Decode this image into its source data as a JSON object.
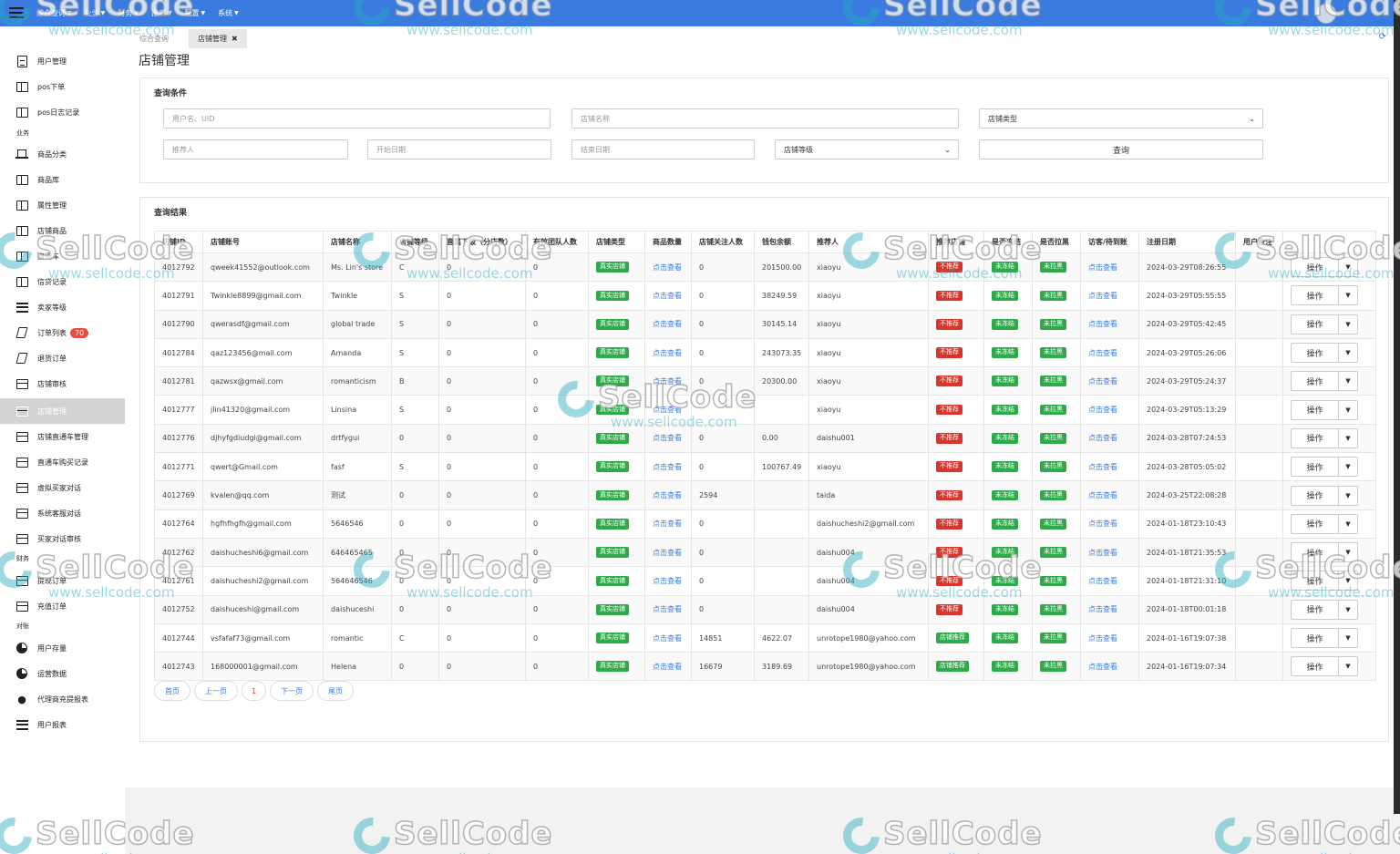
{
  "topbar": {
    "nav": [
      "综合查询",
      "业务",
      "财务",
      "报表",
      "配置",
      "系统"
    ]
  },
  "sidebar": {
    "items": [
      {
        "label": "用户管理",
        "icon": "user-doc-icon"
      },
      {
        "label": "pos下单",
        "icon": "pos-order-icon"
      },
      {
        "label": "pos日志记录",
        "icon": "pos-log-icon"
      },
      {
        "label": "商品分类",
        "icon": "laptop-icon"
      },
      {
        "label": "商品库",
        "icon": "product-lib-icon"
      },
      {
        "label": "属性管理",
        "icon": "attribute-icon"
      },
      {
        "label": "店铺商品",
        "icon": "shop-goods-icon"
      },
      {
        "label": "直通车",
        "icon": "express-icon"
      },
      {
        "label": "信贷记录",
        "icon": "credit-icon"
      },
      {
        "label": "卖家等级",
        "icon": "list-icon"
      },
      {
        "label": "订单列表",
        "icon": "order-icon",
        "badge": "70"
      },
      {
        "label": "退货订单",
        "icon": "return-icon"
      },
      {
        "label": "店铺审核",
        "icon": "audit-icon"
      },
      {
        "label": "店铺管理",
        "icon": "shop-manage-icon"
      },
      {
        "label": "店铺直通车管理",
        "icon": "shop-express-icon"
      },
      {
        "label": "直通车购买记录",
        "icon": "express-record-icon"
      },
      {
        "label": "虚拟买家对话",
        "icon": "virtual-chat-icon"
      },
      {
        "label": "系统客服对话",
        "icon": "service-chat-icon"
      },
      {
        "label": "买家对话审核",
        "icon": "chat-audit-icon"
      },
      {
        "label": "提现订单",
        "icon": "withdraw-icon"
      },
      {
        "label": "充值订单",
        "icon": "recharge-icon"
      },
      {
        "label": "用户存量",
        "icon": "pie-icon"
      },
      {
        "label": "运营数据",
        "icon": "pie-icon"
      },
      {
        "label": "代理商充提报表",
        "icon": "org-icon"
      },
      {
        "label": "用户报表",
        "icon": "list-icon"
      }
    ],
    "sections": [
      "业务",
      "财务",
      "对账"
    ]
  },
  "tabs": [
    {
      "label": "综合查询"
    },
    {
      "label": "店铺管理",
      "close": "✖"
    }
  ],
  "page_title": "店铺管理",
  "query": {
    "title": "查询条件",
    "user_placeholder": "用户名、UID",
    "shop_name_placeholder": "店铺名称",
    "shop_type_label": "店铺类型",
    "recommender_placeholder": "推荐人",
    "start_date_placeholder": "开始日期",
    "end_date_placeholder": "结束日期",
    "shop_level_label": "店铺等级",
    "search_label": "查询"
  },
  "results": {
    "title": "查询结果",
    "columns": [
      "店铺ID",
      "店铺账号",
      "店铺名称",
      "店铺等级",
      "直属下级（分店数）",
      "有效团队人数",
      "店铺类型",
      "商品数量",
      "店铺关注人数",
      "钱包余额",
      "推荐人",
      "推荐店铺",
      "是否冻结",
      "是否拉黑",
      "访客/待到账",
      "注册日期",
      "用户备注",
      ""
    ],
    "view_label": "点击查看",
    "op_label": "操作",
    "op_caret": "▼",
    "rows": [
      {
        "id": "4012792",
        "account": "qweek41552@outlook.com",
        "name": "Ms. Lin's store",
        "level": "C",
        "sub": "0",
        "team": "0",
        "type": "真实店铺",
        "followers": "0",
        "wallet": "201500.00",
        "referrer": "xiaoyu",
        "recommend": "不推荐",
        "frozen": "未冻结",
        "blacklist": "未拉黑",
        "date": "2024-03-29T08:26:55"
      },
      {
        "id": "4012791",
        "account": "Twinkle8899@gmail.com",
        "name": "Twinkle",
        "level": "S",
        "sub": "0",
        "team": "0",
        "type": "真实店铺",
        "followers": "0",
        "wallet": "38249.59",
        "referrer": "xiaoyu",
        "recommend": "不推荐",
        "frozen": "未冻结",
        "blacklist": "未拉黑",
        "date": "2024-03-29T05:55:55"
      },
      {
        "id": "4012790",
        "account": "qwerasdf@gmail.com",
        "name": "global trade",
        "level": "S",
        "sub": "0",
        "team": "0",
        "type": "真实店铺",
        "followers": "0",
        "wallet": "30145.14",
        "referrer": "xiaoyu",
        "recommend": "不推荐",
        "frozen": "未冻结",
        "blacklist": "未拉黑",
        "date": "2024-03-29T05:42:45"
      },
      {
        "id": "4012784",
        "account": "qaz123456@mail.com",
        "name": "Amanda",
        "level": "S",
        "sub": "0",
        "team": "0",
        "type": "真实店铺",
        "followers": "0",
        "wallet": "243073.35",
        "referrer": "xiaoyu",
        "recommend": "不推荐",
        "frozen": "未冻结",
        "blacklist": "未拉黑",
        "date": "2024-03-29T05:26:06"
      },
      {
        "id": "4012781",
        "account": "qazwsx@gmail.com",
        "name": "romanticism",
        "level": "B",
        "sub": "0",
        "team": "0",
        "type": "真实店铺",
        "followers": "0",
        "wallet": "20300.00",
        "referrer": "xiaoyu",
        "recommend": "不推荐",
        "frozen": "未冻结",
        "blacklist": "未拉黑",
        "date": "2024-03-29T05:24:37"
      },
      {
        "id": "4012777",
        "account": "jlin41320@gmail.com",
        "name": "Linsina",
        "level": "S",
        "sub": "0",
        "team": "0",
        "type": "真实店铺",
        "followers": "",
        "wallet": "",
        "referrer": "xiaoyu",
        "recommend": "不推荐",
        "frozen": "未冻结",
        "blacklist": "未拉黑",
        "date": "2024-03-29T05:13:29"
      },
      {
        "id": "4012776",
        "account": "djhyfgdiudgi@gmail.com",
        "name": "drtfygui",
        "level": "0",
        "sub": "0",
        "team": "0",
        "type": "真实店铺",
        "followers": "0",
        "wallet": "0.00",
        "referrer": "daishu001",
        "recommend": "不推荐",
        "frozen": "未冻结",
        "blacklist": "未拉黑",
        "date": "2024-03-28T07:24:53"
      },
      {
        "id": "4012771",
        "account": "qwert@Gmail.com",
        "name": "fasf",
        "level": "S",
        "sub": "0",
        "team": "0",
        "type": "真实店铺",
        "followers": "0",
        "wallet": "100767.49",
        "referrer": "xiaoyu",
        "recommend": "不推荐",
        "frozen": "未冻结",
        "blacklist": "未拉黑",
        "date": "2024-03-28T05:05:02"
      },
      {
        "id": "4012769",
        "account": "kvalen@qq.com",
        "name": "测试",
        "level": "0",
        "sub": "0",
        "team": "0",
        "type": "真实店铺",
        "followers": "2594",
        "wallet": "",
        "referrer": "taida",
        "recommend": "不推荐",
        "frozen": "未冻结",
        "blacklist": "未拉黑",
        "date": "2024-03-25T22:08:28"
      },
      {
        "id": "4012764",
        "account": "hgfhfhgfh@gmail.com",
        "name": "5646546",
        "level": "0",
        "sub": "0",
        "team": "0",
        "type": "真实店铺",
        "followers": "0",
        "wallet": "",
        "referrer": "daishucheshi2@gmail.com",
        "recommend": "不推荐",
        "frozen": "未冻结",
        "blacklist": "未拉黑",
        "date": "2024-01-18T23:10:43"
      },
      {
        "id": "4012762",
        "account": "daishucheshi6@gmail.com",
        "name": "646465465",
        "level": "0",
        "sub": "0",
        "team": "0",
        "type": "真实店铺",
        "followers": "0",
        "wallet": "",
        "referrer": "daishu004",
        "recommend": "不推荐",
        "frozen": "未冻结",
        "blacklist": "未拉黑",
        "date": "2024-01-18T21:35:53"
      },
      {
        "id": "4012761",
        "account": "daishucheshi2@gmail.com",
        "name": "564646546",
        "level": "0",
        "sub": "0",
        "team": "0",
        "type": "真实店铺",
        "followers": "0",
        "wallet": "",
        "referrer": "daishu004",
        "recommend": "不推荐",
        "frozen": "未冻结",
        "blacklist": "未拉黑",
        "date": "2024-01-18T21:31:10"
      },
      {
        "id": "4012752",
        "account": "daishuceshi@gmail.com",
        "name": "daishuceshi",
        "level": "0",
        "sub": "0",
        "team": "0",
        "type": "真实店铺",
        "followers": "0",
        "wallet": "",
        "referrer": "daishu004",
        "recommend": "不推荐",
        "frozen": "未冻结",
        "blacklist": "未拉黑",
        "date": "2024-01-18T00:01:18"
      },
      {
        "id": "4012744",
        "account": "vsfafaf73@gmail.com",
        "name": "romantic",
        "level": "C",
        "sub": "0",
        "team": "0",
        "type": "真实店铺",
        "followers": "14851",
        "wallet": "4622.07",
        "referrer": "unrotope1980@yahoo.com",
        "recommend": "店铺推荐",
        "frozen": "未冻结",
        "blacklist": "未拉黑",
        "date": "2024-01-16T19:07:38"
      },
      {
        "id": "4012743",
        "account": "168000001@gmail.com",
        "name": "Helena",
        "level": "0",
        "sub": "0",
        "team": "0",
        "type": "真实店铺",
        "followers": "16679",
        "wallet": "3189.69",
        "referrer": "unrotope1980@yahoo.com",
        "recommend": "店铺推荐",
        "frozen": "未冻结",
        "blacklist": "未拉黑",
        "date": "2024-01-16T19:07:34"
      }
    ]
  },
  "pagination": {
    "first": "首页",
    "prev": "上一页",
    "current": "1",
    "next": "下一页",
    "last": "尾页"
  },
  "watermark": {
    "brand": "SellCode",
    "url": "www.sellcode.com"
  },
  "colors": {
    "topbar": "#3a7be0",
    "green_badge": "#2eaa4a",
    "red_badge": "#d9352c",
    "link": "#3a7be0"
  }
}
